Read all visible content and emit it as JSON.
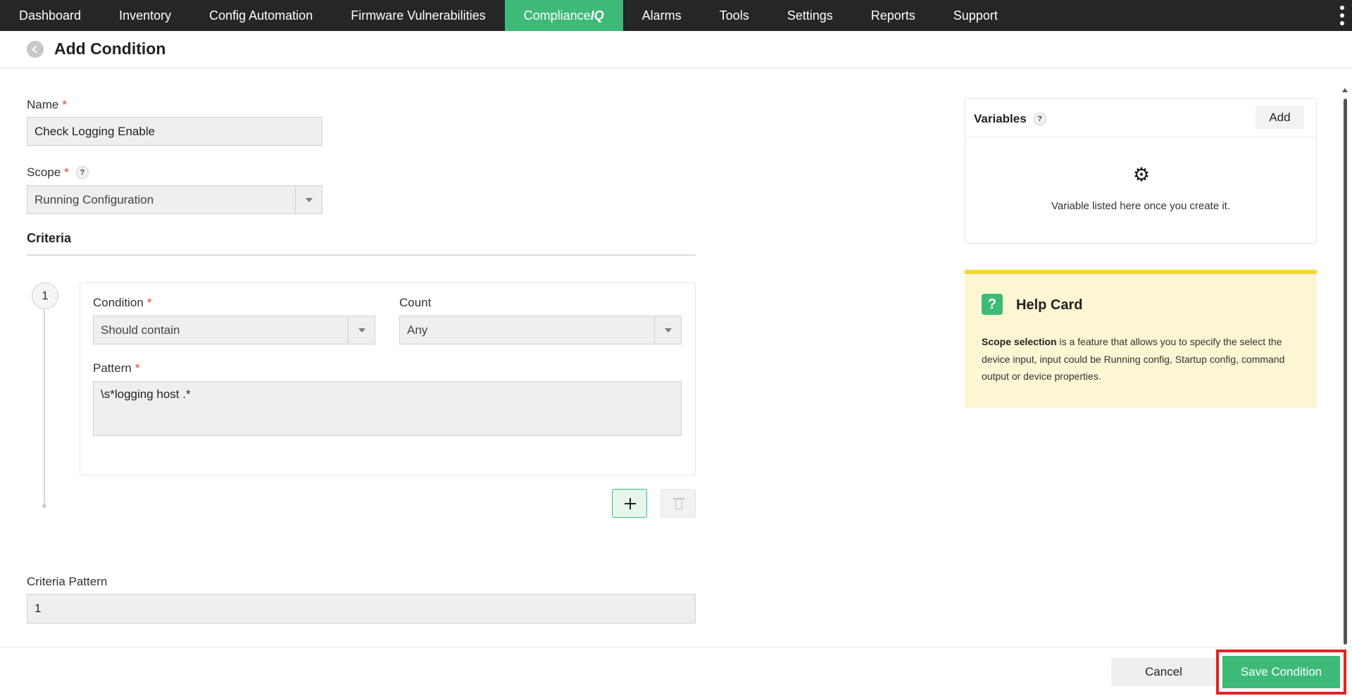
{
  "nav": {
    "items": [
      "Dashboard",
      "Inventory",
      "Config Automation",
      "Firmware Vulnerabilities",
      "Compliance",
      "Alarms",
      "Tools",
      "Settings",
      "Reports",
      "Support"
    ],
    "active_suffix": "IQ"
  },
  "header": {
    "title": "Add Condition"
  },
  "form": {
    "name_label": "Name",
    "name_value": "Check Logging Enable",
    "required_mark": "*",
    "scope_label": "Scope",
    "scope_help": "?",
    "scope_value": "Running Configuration",
    "criteria_title": "Criteria",
    "step_number": "1",
    "condition_label": "Condition",
    "condition_value": "Should contain",
    "count_label": "Count",
    "count_value": "Any",
    "pattern_label": "Pattern",
    "pattern_value": "\\s*logging host .*",
    "criteria_pattern_label": "Criteria Pattern",
    "criteria_pattern_value": "1"
  },
  "variables": {
    "title": "Variables",
    "help": "?",
    "add_label": "Add",
    "empty_text": "Variable listed here once you create it."
  },
  "help_card": {
    "icon": "?",
    "title": "Help Card",
    "bold": "Scope selection",
    "text": " is a feature that allows you to specify the select the device input, input could be Running config, Startup config, command output or device properties."
  },
  "footer": {
    "cancel_label": "Cancel",
    "save_label": "Save Condition"
  },
  "colors": {
    "accent": "#3dba77",
    "nav_bg": "#262626",
    "highlight": "#e52222",
    "help_card_bg": "#fdf6d3"
  }
}
